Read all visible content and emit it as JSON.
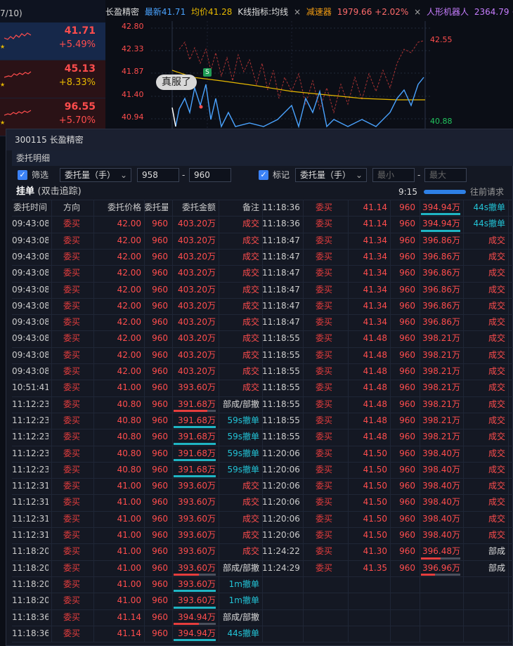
{
  "background": {
    "top_left_text": "7/10)",
    "watchlist": [
      {
        "price": "41.71",
        "change": "+5.49%"
      },
      {
        "price": "45.13",
        "change": "+8.33%"
      },
      {
        "price": "96.55",
        "change": "+5.70%"
      }
    ],
    "header": [
      {
        "text": "长盈精密",
        "color": "#dddddd"
      },
      {
        "text": "最新41.71",
        "color": "#4aa3ff"
      },
      {
        "text": "均价41.28",
        "color": "#e6b800"
      },
      {
        "text": "K线指标:均线",
        "color": "#dddddd"
      },
      {
        "text": "×",
        "color": "#aaaaaa"
      },
      {
        "text": "减速器",
        "color": "#f39c12"
      },
      {
        "text": "1979.66 +2.02%",
        "color": "#ff6b6b"
      },
      {
        "text": "×",
        "color": "#aaaaaa"
      },
      {
        "text": "人形机器人",
        "color": "#c77dff"
      },
      {
        "text": "2364.79 +1.",
        "color": "#c77dff"
      }
    ],
    "y_ticks": [
      "42.80",
      "42.33",
      "41.87",
      "41.40",
      "40.94"
    ],
    "right_labels": {
      "high": "42.55",
      "low": "40.88"
    },
    "s_marker": "S",
    "bubble": "真服了"
  },
  "dialog": {
    "title": "300115 长盈精密",
    "subtitle": "委托明细",
    "filter": {
      "check1": "✓",
      "label1": "筛选",
      "select1": "委托量（手）",
      "min1": "958",
      "dash": "-",
      "max1": "960",
      "check2": "✓",
      "label2": "标记",
      "select2": "委托量（手）",
      "min2_ph": "最小",
      "max2_ph": "最大",
      "chev": "⌄"
    },
    "section": {
      "title": "挂单",
      "subtitle": "(双击追踪)",
      "time": "9:15",
      "request": "往前请求"
    },
    "columns": [
      "委托时间",
      "方向",
      "委托价格",
      "委托量",
      "委托金额",
      "备注"
    ],
    "left_rows": [
      [
        "09:43:08",
        "委买",
        "42.00",
        "960",
        "403.20万",
        "成交"
      ],
      [
        "09:43:08",
        "委买",
        "42.00",
        "960",
        "403.20万",
        "成交"
      ],
      [
        "09:43:08",
        "委买",
        "42.00",
        "960",
        "403.20万",
        "成交"
      ],
      [
        "09:43:08",
        "委买",
        "42.00",
        "960",
        "403.20万",
        "成交"
      ],
      [
        "09:43:08",
        "委买",
        "42.00",
        "960",
        "403.20万",
        "成交"
      ],
      [
        "09:43:08",
        "委买",
        "42.00",
        "960",
        "403.20万",
        "成交"
      ],
      [
        "09:43:08",
        "委买",
        "42.00",
        "960",
        "403.20万",
        "成交"
      ],
      [
        "09:43:08",
        "委买",
        "42.00",
        "960",
        "403.20万",
        "成交"
      ],
      [
        "09:43:08",
        "委买",
        "42.00",
        "960",
        "403.20万",
        "成交"
      ],
      [
        "09:43:08",
        "委买",
        "42.00",
        "960",
        "403.20万",
        "成交"
      ],
      [
        "10:51:41",
        "委买",
        "41.00",
        "960",
        "393.60万",
        "成交"
      ],
      [
        "11:12:23",
        "委买",
        "40.80",
        "960",
        "391.68万",
        "部成/部撤"
      ],
      [
        "11:12:23",
        "委买",
        "40.80",
        "960",
        "391.68万",
        "59s撤单"
      ],
      [
        "11:12:23",
        "委买",
        "40.80",
        "960",
        "391.68万",
        "59s撤单"
      ],
      [
        "11:12:23",
        "委买",
        "40.80",
        "960",
        "391.68万",
        "59s撤单"
      ],
      [
        "11:12:23",
        "委买",
        "40.80",
        "960",
        "391.68万",
        "59s撤单"
      ],
      [
        "11:12:31",
        "委买",
        "41.00",
        "960",
        "393.60万",
        "成交"
      ],
      [
        "11:12:31",
        "委买",
        "41.00",
        "960",
        "393.60万",
        "成交"
      ],
      [
        "11:12:31",
        "委买",
        "41.00",
        "960",
        "393.60万",
        "成交"
      ],
      [
        "11:12:31",
        "委买",
        "41.00",
        "960",
        "393.60万",
        "成交"
      ],
      [
        "11:18:20",
        "委买",
        "41.00",
        "960",
        "393.60万",
        "成交"
      ],
      [
        "11:18:20",
        "委买",
        "41.00",
        "960",
        "393.60万",
        "部成/部撤"
      ],
      [
        "11:18:20",
        "委买",
        "41.00",
        "960",
        "393.60万",
        "1m撤单"
      ],
      [
        "11:18:20",
        "委买",
        "41.00",
        "960",
        "393.60万",
        "1m撤单"
      ],
      [
        "11:18:36",
        "委买",
        "41.14",
        "960",
        "394.94万",
        "部成/部撤"
      ],
      [
        "11:18:36",
        "委买",
        "41.14",
        "960",
        "394.94万",
        "44s撤单"
      ]
    ],
    "left_marks": [
      null,
      null,
      null,
      null,
      null,
      null,
      null,
      null,
      null,
      null,
      null,
      {
        "fill": 0.8,
        "color": "#e63d3d"
      },
      {
        "fill": 1,
        "color": "#1fb5c4"
      },
      {
        "fill": 1,
        "color": "#1fb5c4"
      },
      {
        "fill": 1,
        "color": "#1fb5c4"
      },
      {
        "fill": 1,
        "color": "#1fb5c4"
      },
      null,
      null,
      null,
      null,
      null,
      {
        "fill": 0.6,
        "color": "#e63d3d"
      },
      {
        "fill": 1,
        "color": "#1fb5c4"
      },
      {
        "fill": 1,
        "color": "#1fb5c4"
      },
      {
        "fill": 0.6,
        "color": "#e63d3d"
      },
      {
        "fill": 1,
        "color": "#1fb5c4"
      }
    ],
    "right_rows": [
      [
        "11:18:36",
        "委买",
        "41.14",
        "960",
        "394.94万",
        "44s撤单"
      ],
      [
        "11:18:36",
        "委买",
        "41.14",
        "960",
        "394.94万",
        "44s撤单"
      ],
      [
        "11:18:47",
        "委买",
        "41.34",
        "960",
        "396.86万",
        "成交"
      ],
      [
        "11:18:47",
        "委买",
        "41.34",
        "960",
        "396.86万",
        "成交"
      ],
      [
        "11:18:47",
        "委买",
        "41.34",
        "960",
        "396.86万",
        "成交"
      ],
      [
        "11:18:47",
        "委买",
        "41.34",
        "960",
        "396.86万",
        "成交"
      ],
      [
        "11:18:47",
        "委买",
        "41.34",
        "960",
        "396.86万",
        "成交"
      ],
      [
        "11:18:47",
        "委买",
        "41.34",
        "960",
        "396.86万",
        "成交"
      ],
      [
        "11:18:55",
        "委买",
        "41.48",
        "960",
        "398.21万",
        "成交"
      ],
      [
        "11:18:55",
        "委买",
        "41.48",
        "960",
        "398.21万",
        "成交"
      ],
      [
        "11:18:55",
        "委买",
        "41.48",
        "960",
        "398.21万",
        "成交"
      ],
      [
        "11:18:55",
        "委买",
        "41.48",
        "960",
        "398.21万",
        "成交"
      ],
      [
        "11:18:55",
        "委买",
        "41.48",
        "960",
        "398.21万",
        "成交"
      ],
      [
        "11:18:55",
        "委买",
        "41.48",
        "960",
        "398.21万",
        "成交"
      ],
      [
        "11:18:55",
        "委买",
        "41.48",
        "960",
        "398.21万",
        "成交"
      ],
      [
        "11:20:06",
        "委买",
        "41.50",
        "960",
        "398.40万",
        "成交"
      ],
      [
        "11:20:06",
        "委买",
        "41.50",
        "960",
        "398.40万",
        "成交"
      ],
      [
        "11:20:06",
        "委买",
        "41.50",
        "960",
        "398.40万",
        "成交"
      ],
      [
        "11:20:06",
        "委买",
        "41.50",
        "960",
        "398.40万",
        "成交"
      ],
      [
        "11:20:06",
        "委买",
        "41.50",
        "960",
        "398.40万",
        "成交"
      ],
      [
        "11:20:06",
        "委买",
        "41.50",
        "960",
        "398.40万",
        "成交"
      ],
      [
        "11:24:22",
        "委买",
        "41.30",
        "960",
        "396.48万",
        "部成"
      ],
      [
        "11:24:29",
        "委买",
        "41.35",
        "960",
        "396.96万",
        "部成"
      ]
    ],
    "right_marks": [
      {
        "fill": 1,
        "color": "#1fb5c4"
      },
      {
        "fill": 1,
        "color": "#1fb5c4"
      },
      null,
      null,
      null,
      null,
      null,
      null,
      null,
      null,
      null,
      null,
      null,
      null,
      null,
      null,
      null,
      null,
      null,
      null,
      null,
      {
        "fill": 0.5,
        "color": "#e63d3d"
      },
      {
        "fill": 0.35,
        "color": "#e63d3d"
      }
    ]
  }
}
